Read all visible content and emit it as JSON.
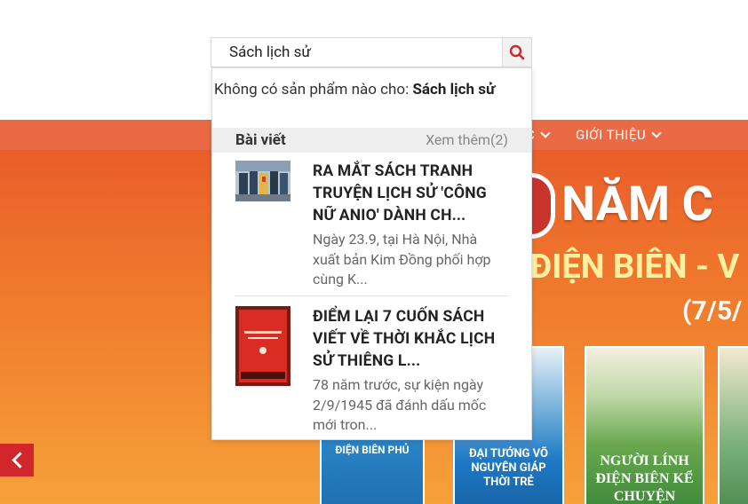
{
  "search": {
    "value": "Sách lịch sử",
    "no_result_prefix": "Không có sản phẩm nào cho: ",
    "no_result_query": "Sách lịch sử"
  },
  "dropdown": {
    "section_title": "Bài viết",
    "more_label": "Xem thêm(2)",
    "posts": [
      {
        "title": "RA MẮT SÁCH TRANH TRUYỆN LỊCH SỬ 'CÔNG NỮ ANIO' DÀNH CH...",
        "description": "Ngày 23.9, tại Hà Nội, Nhà xuất bản Kim Đồng phối hợp cùng K..."
      },
      {
        "title": "ĐIỂM LẠI 7 CUỐN SÁCH VIẾT VỀ THỜI KHẮC LỊCH SỬ THIÊNG L...",
        "description": "78 năm trước, sự kiện ngày 2/9/1945 đã đánh dấu mốc mới tron..."
      }
    ]
  },
  "nav": {
    "partial_item": "C",
    "about": "GIỚI THIỆU"
  },
  "banner": {
    "title": "NĂM C",
    "subtitle": "ĐIỆN BIÊN - V",
    "date": "(7/5/",
    "books": [
      {
        "title": "ĐIỆN BIÊN PHỦ"
      },
      {
        "title": "ĐẠI TƯỚNG VÕ NGUYÊN GIÁP THỜI TRẺ"
      },
      {
        "title": "NGƯỜI LÍNH ĐIỆN BIÊN KỂ CHUYỆN"
      }
    ]
  },
  "colors": {
    "accent": "#d0262c",
    "banner": "#f07a2c"
  }
}
